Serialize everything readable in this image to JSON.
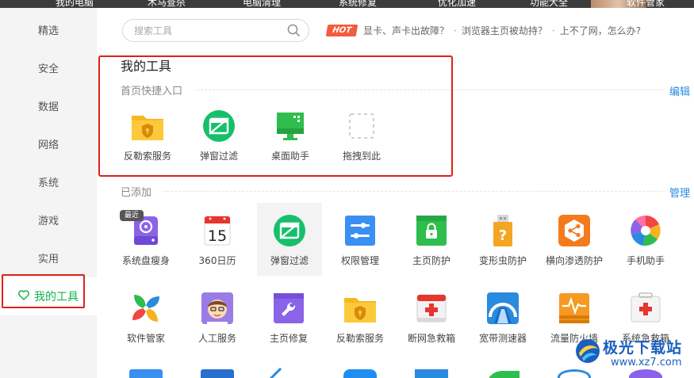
{
  "topnav": {
    "items": [
      "我的电脑",
      "木马查杀",
      "电脑清理",
      "系统修复",
      "优化加速",
      "功能大全",
      "软件管家"
    ]
  },
  "sidebar": {
    "items": [
      {
        "label": "精选"
      },
      {
        "label": "安全"
      },
      {
        "label": "数据"
      },
      {
        "label": "网络"
      },
      {
        "label": "系统"
      },
      {
        "label": "游戏"
      },
      {
        "label": "实用"
      },
      {
        "label": "我的工具",
        "active": true
      }
    ]
  },
  "search": {
    "placeholder": "搜索工具"
  },
  "hot": {
    "badge": "HOT",
    "items": [
      "显卡、声卡出故障？",
      "浏览器主页被劫持？",
      "上不了网，怎么办?"
    ],
    "separator": "·"
  },
  "my_tools": {
    "title": "我的工具",
    "quick_entry": {
      "heading": "首页快捷入口",
      "edit_link": "编辑",
      "items": [
        {
          "label": "反勒索服务",
          "icon": "shield-folder-icon"
        },
        {
          "label": "弹窗过滤",
          "icon": "popup-block-icon"
        },
        {
          "label": "桌面助手",
          "icon": "desktop-monitor-icon"
        },
        {
          "label": "拖拽到此",
          "icon": "dashed-drop-icon"
        }
      ]
    },
    "added": {
      "heading": "已添加",
      "manage_link": "管理",
      "recent_badge": "最近",
      "row1": [
        {
          "label": "系统盘瘦身",
          "icon": "disk-slim-icon"
        },
        {
          "label": "360日历",
          "icon": "calendar-icon",
          "day": "15"
        },
        {
          "label": "弹窗过滤",
          "icon": "popup-block-icon"
        },
        {
          "label": "权限管理",
          "icon": "permission-toggle-icon"
        },
        {
          "label": "主页防护",
          "icon": "homepage-lock-icon"
        },
        {
          "label": "变形虫防护",
          "icon": "usb-question-icon"
        },
        {
          "label": "横向渗透防护",
          "icon": "share-hexagon-icon"
        },
        {
          "label": "手机助手",
          "icon": "phone-color-wheel-icon"
        }
      ],
      "row2": [
        {
          "label": "软件管家",
          "icon": "software-pinwheel-icon"
        },
        {
          "label": "人工服务",
          "icon": "service-agent-icon"
        },
        {
          "label": "主页修复",
          "icon": "wrench-repair-icon"
        },
        {
          "label": "反勒索服务",
          "icon": "shield-folder-icon"
        },
        {
          "label": "断网急救箱",
          "icon": "first-aid-box-icon"
        },
        {
          "label": "宽带测速器",
          "icon": "speed-gauge-icon"
        },
        {
          "label": "流量防火墙",
          "icon": "traffic-firewall-icon"
        },
        {
          "label": "系统急救箱",
          "icon": "system-aid-box-icon"
        }
      ]
    }
  },
  "watermark": {
    "name": "极光下载站",
    "url": "www.xz7.com"
  },
  "colors": {
    "accent_green": "#12b44a",
    "link_blue": "#2a8adf",
    "highlight_red": "#e0201a",
    "hot_orange": "#f25c3c"
  }
}
